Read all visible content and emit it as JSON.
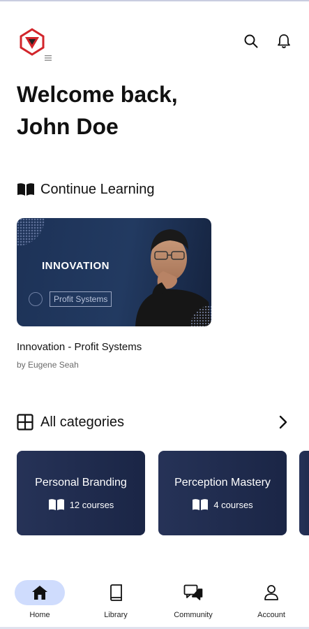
{
  "header": {
    "logo_icon": "triangle-logo-icon",
    "search_icon": "search-icon",
    "notifications_icon": "bell-icon"
  },
  "welcome": {
    "line1": "Welcome back,",
    "line2": "John Doe"
  },
  "continue_learning": {
    "title": "Continue Learning",
    "icon": "open-book-icon",
    "course": {
      "thumbnail_title": "INNOVATION",
      "thumbnail_badge": "Profit Systems",
      "name": "Innovation - Profit Systems",
      "author": "by Eugene Seah"
    }
  },
  "categories": {
    "title": "All categories",
    "icon": "grid-icon",
    "arrow_icon": "chevron-right-icon",
    "items": [
      {
        "name": "Personal Branding",
        "count": "12 courses"
      },
      {
        "name": "Perception Mastery",
        "count": "4 courses"
      }
    ]
  },
  "bottom_nav": {
    "items": [
      {
        "label": "Home",
        "icon": "home-icon",
        "active": true
      },
      {
        "label": "Library",
        "icon": "library-icon",
        "active": false
      },
      {
        "label": "Community",
        "icon": "community-icon",
        "active": false
      },
      {
        "label": "Account",
        "icon": "account-icon",
        "active": false
      }
    ]
  },
  "colors": {
    "brand_red": "#d2252b",
    "card_navy": "#1f2c52",
    "active_pill": "#cfdcfd"
  }
}
